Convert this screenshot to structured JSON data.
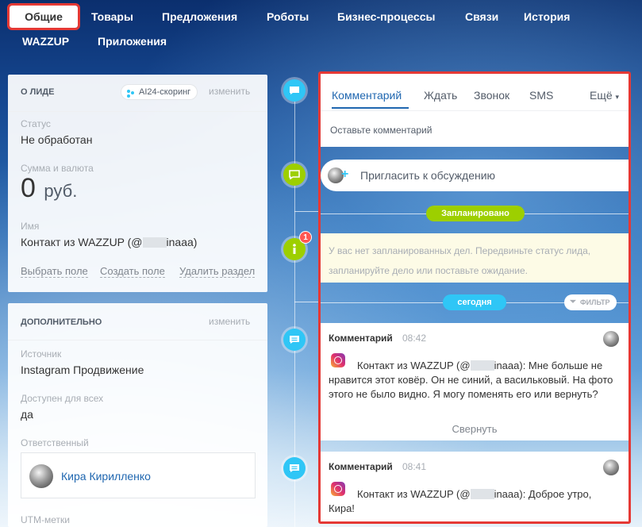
{
  "nav": {
    "items": [
      {
        "label": "Общие"
      },
      {
        "label": "Товары"
      },
      {
        "label": "Предложения"
      },
      {
        "label": "Роботы"
      },
      {
        "label": "Бизнес-процессы"
      },
      {
        "label": "Связи"
      },
      {
        "label": "История"
      },
      {
        "label": "WAZZUP"
      },
      {
        "label": "Приложения"
      }
    ]
  },
  "lead_card": {
    "title": "О ЛИДЕ",
    "scoring_badge": "AI24-скоринг",
    "change_label": "изменить",
    "status_label": "Статус",
    "status_value": "Не обработан",
    "amount_label": "Сумма и валюта",
    "amount_value": "0",
    "currency": "руб.",
    "name_label": "Имя",
    "name_prefix": "Контакт из WAZZUP (@",
    "name_suffix": "inaaa)",
    "select_field": "Выбрать поле",
    "create_field": "Создать поле",
    "delete_section": "Удалить раздел"
  },
  "extra_card": {
    "title": "ДОПОЛНИТЕЛЬНО",
    "change_label": "изменить",
    "source_label": "Источник",
    "source_value": "Instagram Продвижение",
    "available_label": "Доступен для всех",
    "available_value": "да",
    "responsible_label": "Ответственный",
    "responsible_name": "Кира Кирилленко",
    "utm_label": "UTM-метки"
  },
  "timeline": {
    "badge_count": "1"
  },
  "editor": {
    "tabs": [
      {
        "label": "Комментарий"
      },
      {
        "label": "Ждать"
      },
      {
        "label": "Звонок"
      },
      {
        "label": "SMS"
      }
    ],
    "more_label": "Ещё",
    "placeholder": "Оставьте комментарий"
  },
  "invite": {
    "label": "Пригласить к обсуждению"
  },
  "planned": {
    "label": "Запланировано",
    "empty_text": "У вас нет запланированных дел. Передвиньте статус лида, запланируйте дело или поставьте ожидание."
  },
  "today": {
    "label": "сегодня",
    "filter_label": "ФИЛЬТР"
  },
  "comments": [
    {
      "title": "Комментарий",
      "time": "08:42",
      "text_prefix": "Контакт из WAZZUP (@",
      "text_suffix": "inaaa): Мне больше не нравится этот ковёр. Он не синий, а васильковый. На фото этого не было видно.   Я могу поменять его или вернуть?",
      "collapse_label": "Свернуть"
    },
    {
      "title": "Комментарий",
      "time": "08:41",
      "text_prefix": "Контакт из WAZZUP (@",
      "text_suffix": "inaaa): Доброе утро, Кира!"
    }
  ],
  "colors": {
    "accent_blue": "#2fc6f6",
    "accent_green": "#9dcf00",
    "highlight_red": "#e53935",
    "link_blue": "#2067b0"
  }
}
